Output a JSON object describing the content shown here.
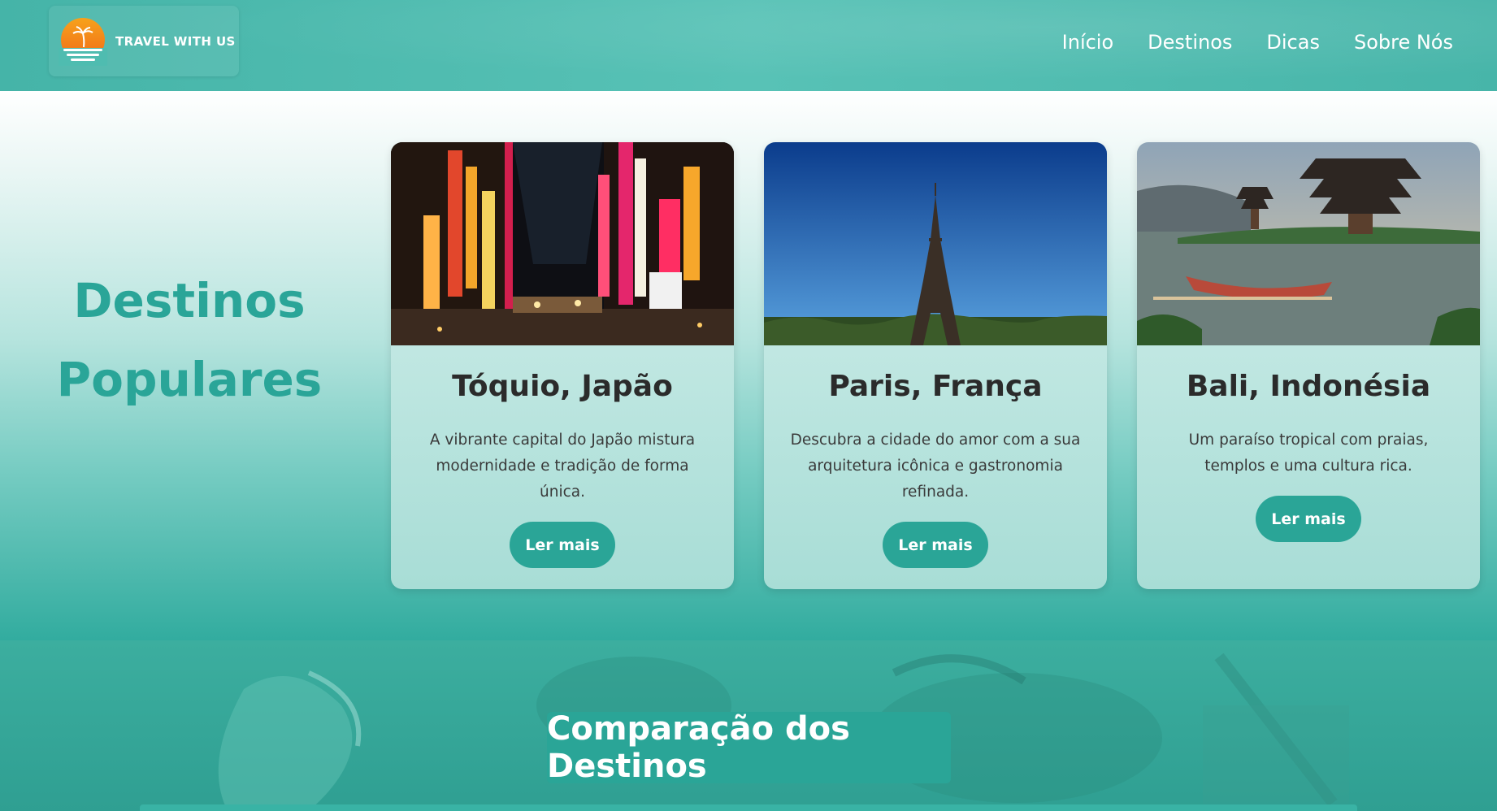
{
  "header": {
    "logo_text": "TRAVEL WITH US",
    "nav": [
      "Início",
      "Destinos",
      "Dicas",
      "Sobre Nós"
    ]
  },
  "destinos": {
    "title_line1": "Destinos",
    "title_line2": "Populares",
    "cards": [
      {
        "title": "Tóquio, Japão",
        "description": "A vibrante capital do Japão mistura modernidade e tradição de forma única.",
        "button": "Ler mais"
      },
      {
        "title": "Paris, França",
        "description": "Descubra a cidade do amor com a sua arquitetura icônica e gastronomia refinada.",
        "button": "Ler mais"
      },
      {
        "title": "Bali, Indonésia",
        "description": "Um paraíso tropical com praias, templos e uma cultura rica.",
        "button": "Ler mais"
      }
    ]
  },
  "comparison": {
    "title": "Comparação dos Destinos"
  },
  "colors": {
    "accent": "#2aa597",
    "header": "#4fbcb0",
    "title_text": "#2aa598"
  }
}
